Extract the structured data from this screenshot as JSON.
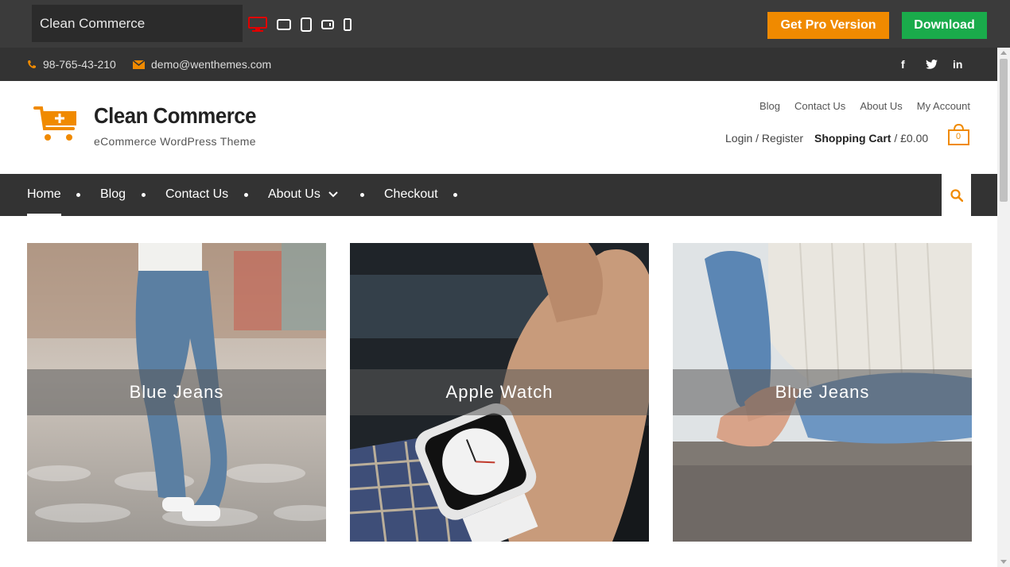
{
  "demo_bar": {
    "theme_name": "Clean Commerce",
    "devices": [
      "desktop-icon",
      "laptop-icon",
      "tablet-icon",
      "tablet-landscape-icon",
      "mobile-icon"
    ],
    "active_device": "desktop-icon",
    "pro_button": "Get Pro Version",
    "download_button": "Download",
    "colors": {
      "pro": "#f08a00",
      "download": "#1aab4b",
      "active_device": "#e00000"
    }
  },
  "topbar": {
    "phone": "98-765-43-210",
    "email": "demo@wenthemes.com",
    "social": [
      "f",
      "t",
      "in"
    ],
    "accent": "#f08a00"
  },
  "header": {
    "title": "Clean Commerce",
    "tagline": "eCommerce WordPress Theme",
    "top_links": [
      "Blog",
      "Contact Us",
      "About Us",
      "My Account"
    ],
    "login": "Login / Register",
    "cart_label": "Shopping Cart",
    "cart_separator": " / ",
    "cart_total": "£0.00",
    "cart_count": "0"
  },
  "nav": {
    "items": [
      "Home",
      "Blog",
      "Contact Us",
      "About Us",
      "Checkout"
    ],
    "active": "Home"
  },
  "products": [
    {
      "label": "Blue Jeans"
    },
    {
      "label": "Apple Watch"
    },
    {
      "label": "Blue Jeans"
    }
  ]
}
